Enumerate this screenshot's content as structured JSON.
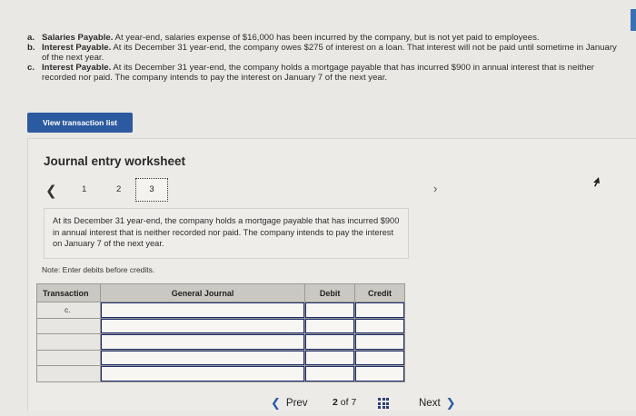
{
  "problem": {
    "items": [
      {
        "letter": "a.",
        "title": "Salaries Payable.",
        "text": " At year-end, salaries expense of $16,000 has been incurred by the company, but is not yet paid to employees."
      },
      {
        "letter": "b.",
        "title": "Interest Payable.",
        "text": " At its December 31 year-end, the company owes $275 of interest on a loan. That interest will not be paid until sometime in January of the next year."
      },
      {
        "letter": "c.",
        "title": "Interest Payable.",
        "text": " At its December 31 year-end, the company holds a mortgage payable that has incurred $900 in annual interest that is neither recorded nor paid. The company intends to pay the interest on January 7 of the next year."
      }
    ]
  },
  "view_button_label": "View transaction list",
  "worksheet": {
    "title": "Journal entry worksheet",
    "pages": [
      "1",
      "2",
      "3"
    ],
    "active_page": "3",
    "prompt": "At its December 31 year-end, the company holds a mortgage payable that has incurred $900 in annual interest that is neither recorded nor paid. The company intends to pay the interest on January 7 of the next year.",
    "note": "Note: Enter debits before credits."
  },
  "journal": {
    "headers": {
      "transaction": "Transaction",
      "general_journal": "General Journal",
      "debit": "Debit",
      "credit": "Credit"
    },
    "first_transaction": "c."
  },
  "footer": {
    "prev_label": "Prev",
    "current": "2",
    "of_label": "of",
    "total": "7",
    "next_label": "Next"
  },
  "colors": {
    "accent": "#2c5aa0",
    "header_bg": "#c9c8c3"
  }
}
